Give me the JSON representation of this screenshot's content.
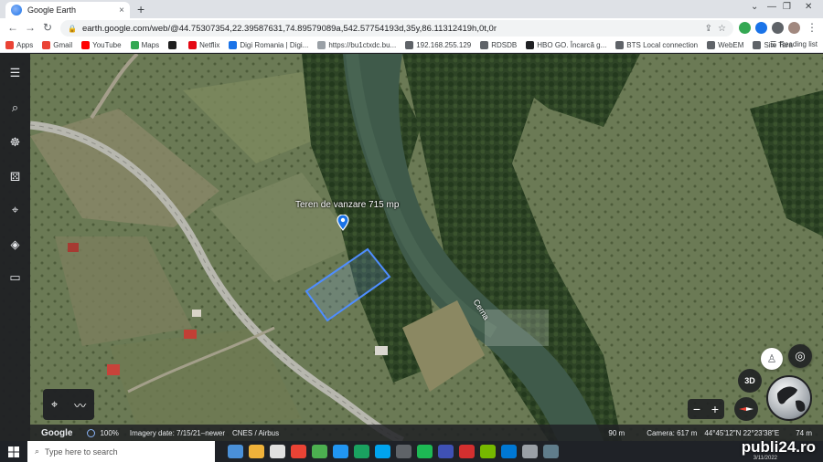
{
  "browser": {
    "tab_title": "Google Earth",
    "new_tab": "+",
    "close_tab": "×",
    "url": "earth.google.com/web/@44.75307354,22.39587631,74.89579089a,542.57754193d,35y,86.11312419h,0t,0r",
    "window_min": "—",
    "window_max": "❐",
    "window_close": "✕",
    "back": "←",
    "forward": "→",
    "reload": "↻"
  },
  "bookmarks": {
    "items": [
      {
        "label": "Apps",
        "color": "#ea4335"
      },
      {
        "label": "Gmail",
        "color": "#ea4335"
      },
      {
        "label": "YouTube",
        "color": "#ff0000"
      },
      {
        "label": "Maps",
        "color": "#34a853"
      },
      {
        "label": "",
        "color": "#1f1f1f"
      },
      {
        "label": "Netflix",
        "color": "#e50914"
      },
      {
        "label": "Digi Romania | Digi...",
        "color": "#1a73e8"
      },
      {
        "label": "https://bu1ctxdc.bu...",
        "color": "#9aa0a6"
      },
      {
        "label": "192.168.255.129",
        "color": "#5f6368"
      },
      {
        "label": "RDSDB",
        "color": "#5f6368"
      },
      {
        "label": "HBO GO. Încarcă g...",
        "color": "#202124"
      },
      {
        "label": "BTS Local connection",
        "color": "#5f6368"
      },
      {
        "label": "WebEM",
        "color": "#5f6368"
      },
      {
        "label": "Site Tara",
        "color": "#5f6368"
      }
    ],
    "reading_list": "Reading list"
  },
  "map": {
    "place_label": "Teren de vanzare 715 mp",
    "river_label": "Cerna",
    "btn_3d": "3D",
    "zoom_out": "−",
    "zoom_in": "+"
  },
  "status": {
    "google": "Google",
    "percent": "100%",
    "imagery": "Imagery date: 7/15/21–newer",
    "credits": "CNES / Airbus",
    "scale": "90 m",
    "camera": "Camera: 617 m",
    "coords": "44°45'12\"N 22°23'38\"E",
    "altitude": "74 m"
  },
  "taskbar": {
    "search_placeholder": "Type here to search",
    "icons": [
      "#4a90d9",
      "#f0b23a",
      "#e0e0e0",
      "#ea4335",
      "#4caf50",
      "#2196f3",
      "#1aa260",
      "#00a4ef",
      "#5f6368",
      "#1db954",
      "#3f51b5",
      "#d32f2f",
      "#76b900",
      "#0078d4",
      "#9aa0a6",
      "#607d8b"
    ]
  },
  "watermark": "publi24.ro",
  "datestamp": "3/11/2022"
}
